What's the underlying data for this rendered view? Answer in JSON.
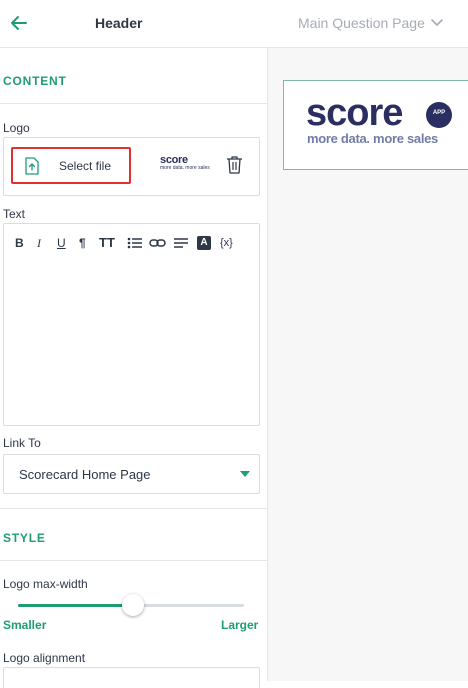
{
  "topbar": {
    "title": "Header",
    "page_select": "Main Question Page"
  },
  "content": {
    "section_label": "CONTENT",
    "logo": {
      "label": "Logo",
      "select_file_label": "Select file",
      "thumbnail": {
        "wordmark": "score",
        "tagline": "more data. more sales"
      }
    },
    "text": {
      "label": "Text",
      "toolbar": [
        "B",
        "I",
        "U",
        "¶",
        "TT",
        "list",
        "link",
        "align",
        "A",
        "{x}"
      ]
    },
    "link_to": {
      "label": "Link To",
      "value": "Scorecard Home Page"
    }
  },
  "style": {
    "section_label": "STYLE",
    "logo_max_width": {
      "label": "Logo max-width",
      "value_fraction": 0.51,
      "min_label": "Smaller",
      "max_label": "Larger"
    },
    "logo_alignment": {
      "label": "Logo alignment"
    }
  },
  "preview": {
    "wordmark": "score",
    "badge": "APP",
    "tagline": "more data. more sales"
  },
  "colors": {
    "accent": "#1e9e70",
    "highlight": "#e0302f",
    "brand_navy": "#2a2e60"
  }
}
